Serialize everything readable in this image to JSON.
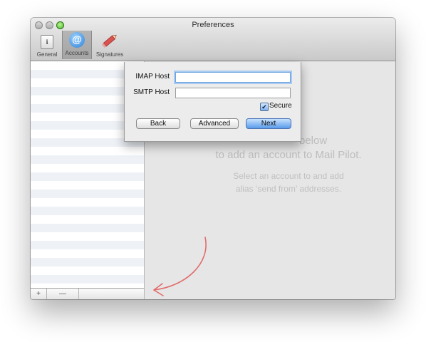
{
  "window": {
    "title": "Preferences"
  },
  "toolbar": {
    "general": "General",
    "accounts": "Accounts",
    "signatures": "Signatures",
    "general_glyph": "ℹ",
    "accounts_glyph": "@"
  },
  "sidebar_footer": {
    "add": "+",
    "remove": "—"
  },
  "main_hint": {
    "line1": "below",
    "line2": "to add an account to Mail Pilot.",
    "line3": "Select an account to and add",
    "line4": "alias ‘send from’ addresses."
  },
  "sheet": {
    "imap_label": "IMAP Host",
    "imap_value": "",
    "smtp_label": "SMTP Host",
    "smtp_value": "",
    "secure_label": "Secure",
    "secure_check": "✔",
    "back": "Back",
    "advanced": "Advanced",
    "next": "Next"
  },
  "colors": {
    "arrow": "#e26b6b",
    "focus": "#a9cbf2",
    "default_button": "#5a9bea"
  }
}
